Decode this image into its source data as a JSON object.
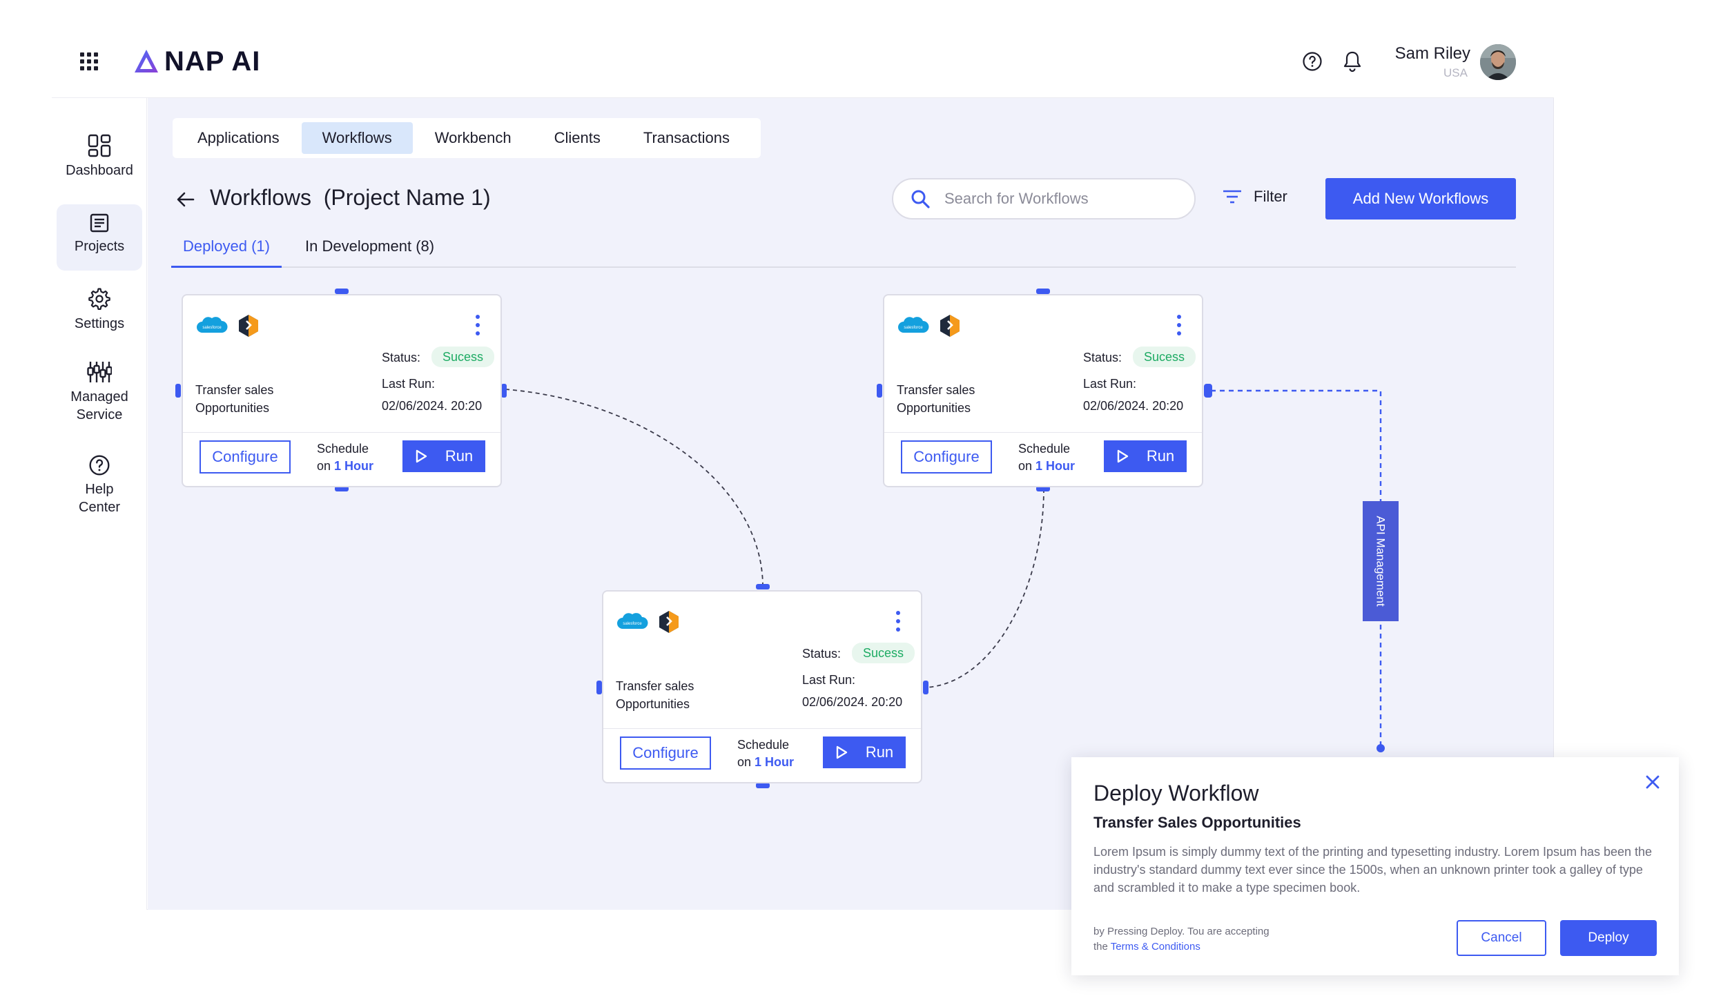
{
  "app": {
    "logo_text": "NAP AI",
    "user": {
      "name": "Sam Riley",
      "country": "USA"
    }
  },
  "sidebar": {
    "items": [
      {
        "label": "Dashboard",
        "icon": "dashboard-icon"
      },
      {
        "label": "Projects",
        "icon": "document-icon"
      },
      {
        "label": "Settings",
        "icon": "gear-icon"
      },
      {
        "label": "Managed Service",
        "icon": "sliders-icon"
      },
      {
        "label": "Help Center",
        "icon": "help-icon"
      }
    ],
    "active": "Projects"
  },
  "top_tabs": [
    "Applications",
    "Workflows",
    "Workbench",
    "Clients",
    "Transactions"
  ],
  "active_top_tab": "Workflows",
  "header": {
    "title": "Workflows  (Project Name 1)",
    "search_placeholder": "Search for Workflows",
    "filter_label": "Filter",
    "add_button": "Add New Workflows"
  },
  "sub_tabs": {
    "deployed": "Deployed (1)",
    "in_development": "In Development (8)"
  },
  "cards": [
    {
      "name": "Transfer sales Opportunities",
      "status_label": "Status:",
      "status": "Sucess",
      "last_run_label": "Last Run:",
      "last_run": "02/06/2024. 20:20",
      "configure_label": "Configure",
      "schedule_text": "Schedule",
      "schedule_on": "on",
      "schedule_interval": "1 Hour",
      "run_label": "Run"
    },
    {
      "name": "Transfer sales Opportunities",
      "status_label": "Status:",
      "status": "Sucess",
      "last_run_label": "Last Run:",
      "last_run": "02/06/2024. 20:20",
      "configure_label": "Configure",
      "schedule_text": "Schedule",
      "schedule_on": "on",
      "schedule_interval": "1 Hour",
      "run_label": "Run"
    },
    {
      "name": "Transfer sales Opportunities",
      "status_label": "Status:",
      "status": "Sucess",
      "last_run_label": "Last Run:",
      "last_run": "02/06/2024. 20:20",
      "configure_label": "Configure",
      "schedule_text": "Schedule",
      "schedule_on": "on",
      "schedule_interval": "1 Hour",
      "run_label": "Run"
    }
  ],
  "api_badge": "API Management",
  "dialog": {
    "title": "Deploy Workflow",
    "subtitle": "Transfer Sales Opportunities",
    "body": "Lorem Ipsum is simply dummy text of the printing and typesetting industry. Lorem Ipsum has been the industry's standard dummy text ever since the 1500s, when an unknown printer took a galley of type and scrambled it to make a type specimen book.",
    "note_line1": "by Pressing Deploy. Tou are accepting",
    "note_the": "the",
    "terms_link": "Terms & Conditions",
    "cancel_label": "Cancel",
    "deploy_label": "Deploy"
  },
  "colors": {
    "accent": "#3d5af1",
    "success_text": "#1dab63",
    "success_bg": "#e8f6ee",
    "canvas_bg": "#f1f2fb",
    "api_badge": "#4b5bd6"
  }
}
